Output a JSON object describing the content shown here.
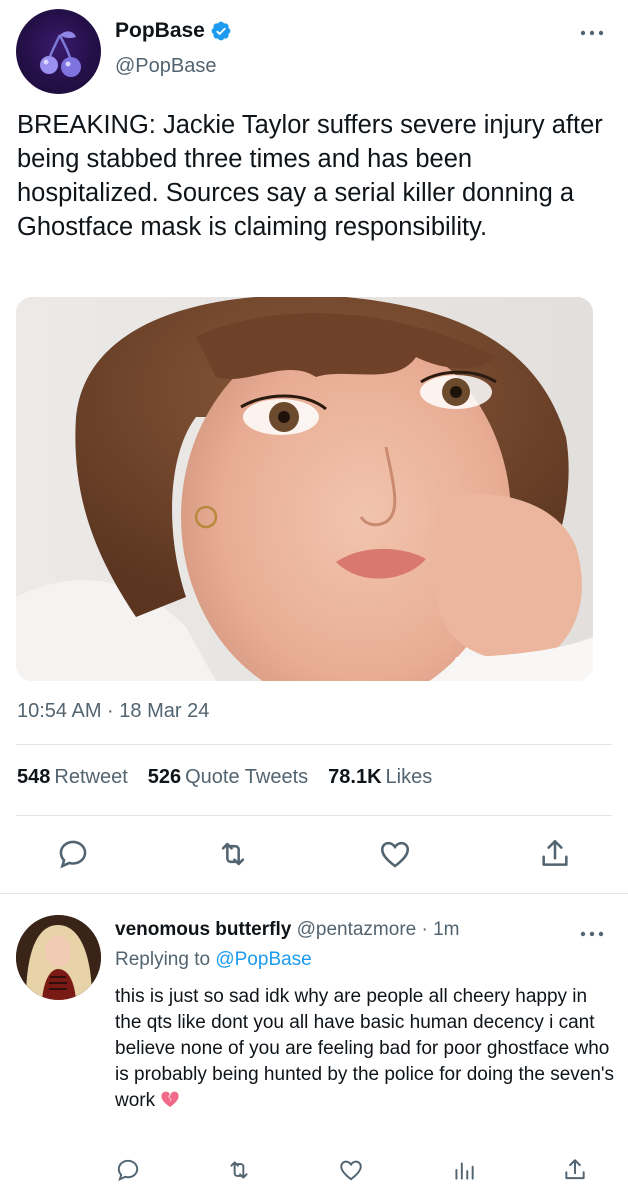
{
  "tweet": {
    "author_name": "PopBase",
    "author_handle": "@PopBase",
    "text": "BREAKING: Jackie Taylor suffers severe injury after being stabbed three times and has been hospitalized. Sources say a serial killer donning a Ghostface mask is claiming responsibility.",
    "timestamp": "10:54 AM · 18 Mar 24",
    "stats": {
      "retweets_count": "548",
      "retweets_label": "Retweet",
      "quotes_count": "526",
      "quotes_label": "Quote Tweets",
      "likes_count": "78.1K",
      "likes_label": "Likes"
    },
    "icons": {
      "avatar": "cherry-logo-icon",
      "verified": "verified-badge-icon",
      "more": "more-dots-icon",
      "reply": "reply-icon",
      "retweet": "retweet-icon",
      "like": "heart-icon",
      "share": "share-icon"
    }
  },
  "reply": {
    "author_name": "venomous butterfly",
    "author_handle": "@pentazmore",
    "time_ago": "· 1m",
    "replying_prefix": "Replying to",
    "replying_to": "@PopBase",
    "text": "this is just so sad idk why are people all cheery happy in the qts like dont you all have basic human decency i cant believe none of you are feeling bad for poor ghostface who is probably being hunted by the police for doing the seven's work",
    "emoji": "broken-heart-icon"
  },
  "colors": {
    "accent": "#1d9bf0",
    "text_primary": "#0f1419",
    "text_secondary": "#536471",
    "divider": "#e1e6ea"
  }
}
